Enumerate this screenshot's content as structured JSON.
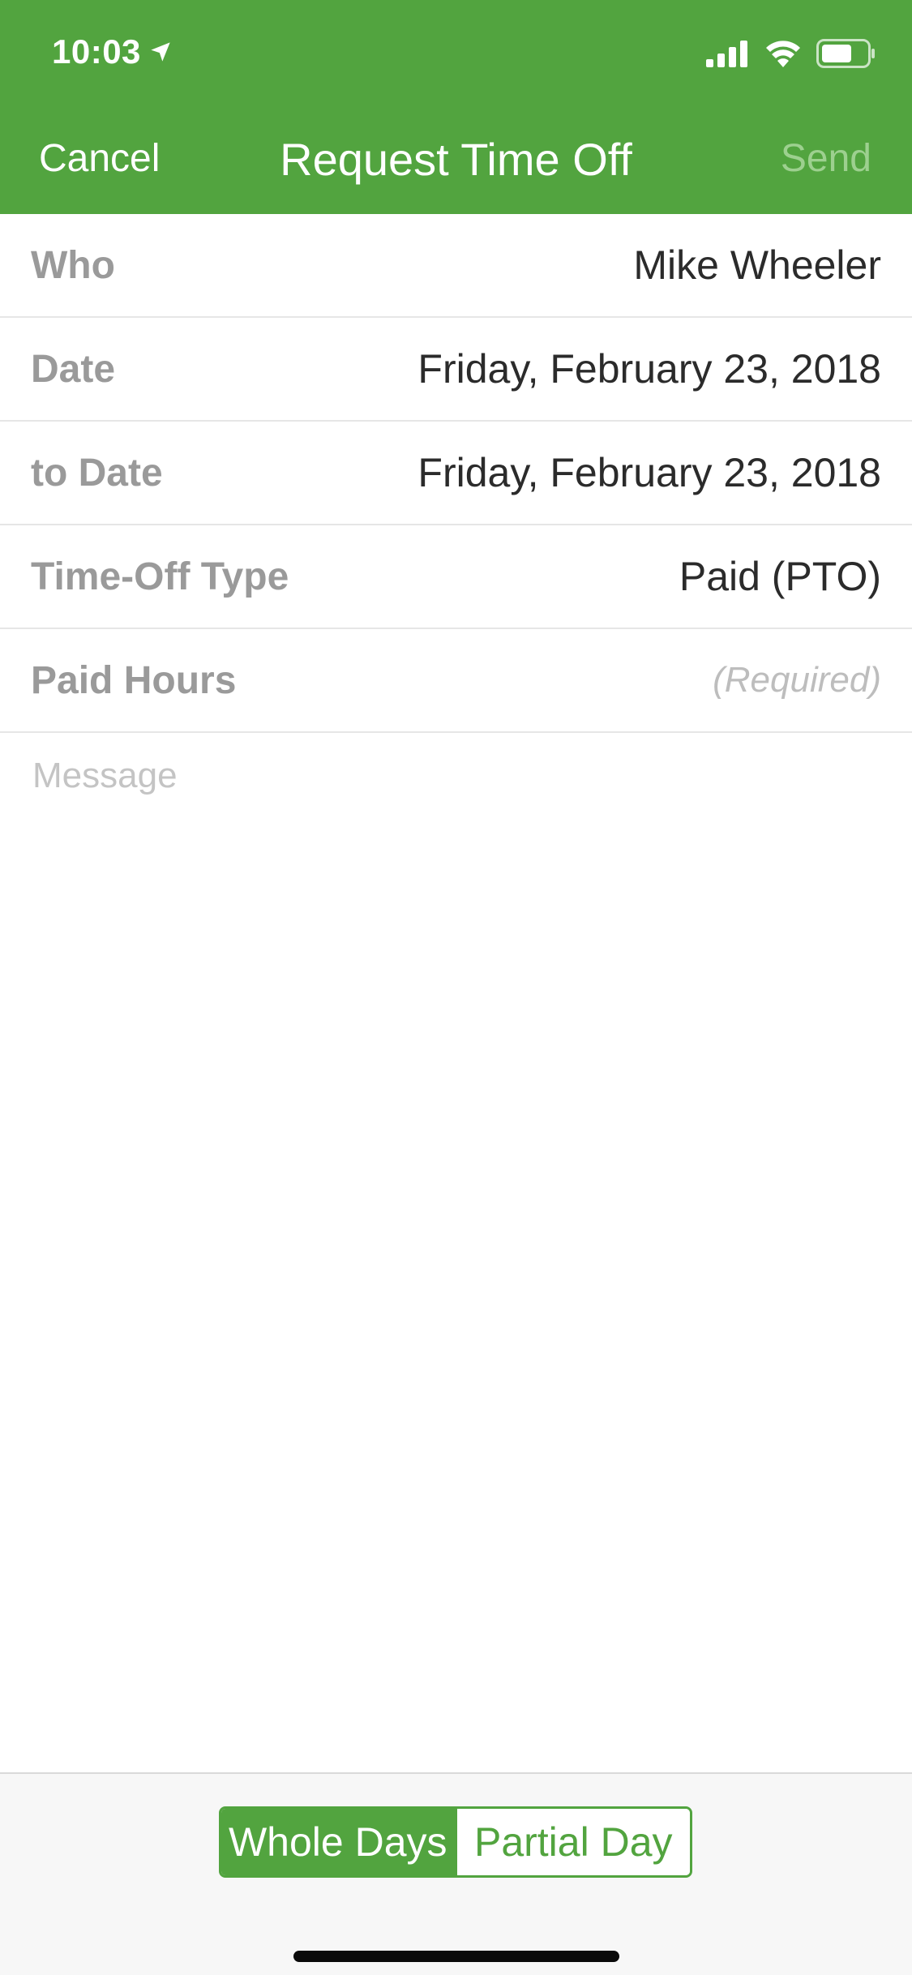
{
  "status_bar": {
    "time": "10:03",
    "icons": [
      "location-arrow-icon",
      "signal-icon",
      "wifi-icon",
      "battery-icon"
    ]
  },
  "nav": {
    "cancel_label": "Cancel",
    "title": "Request Time Off",
    "send_label": "Send"
  },
  "form": {
    "rows": [
      {
        "label": "Who",
        "value": "Mike Wheeler"
      },
      {
        "label": "Date",
        "value": "Friday, February 23, 2018"
      },
      {
        "label": "to Date",
        "value": "Friday, February 23, 2018"
      },
      {
        "label": "Time-Off Type",
        "value": "Paid (PTO)"
      },
      {
        "label": "Paid Hours",
        "placeholder": "(Required)"
      }
    ],
    "message_placeholder": "Message"
  },
  "segmented_control": {
    "options": [
      "Whole Days",
      "Partial Day"
    ],
    "selected": "Whole Days"
  },
  "colors": {
    "brand_green": "#52a43f",
    "send_disabled": "#9dd08f",
    "label_gray": "#9a9a9a",
    "value_dark": "#2b2b2b"
  }
}
